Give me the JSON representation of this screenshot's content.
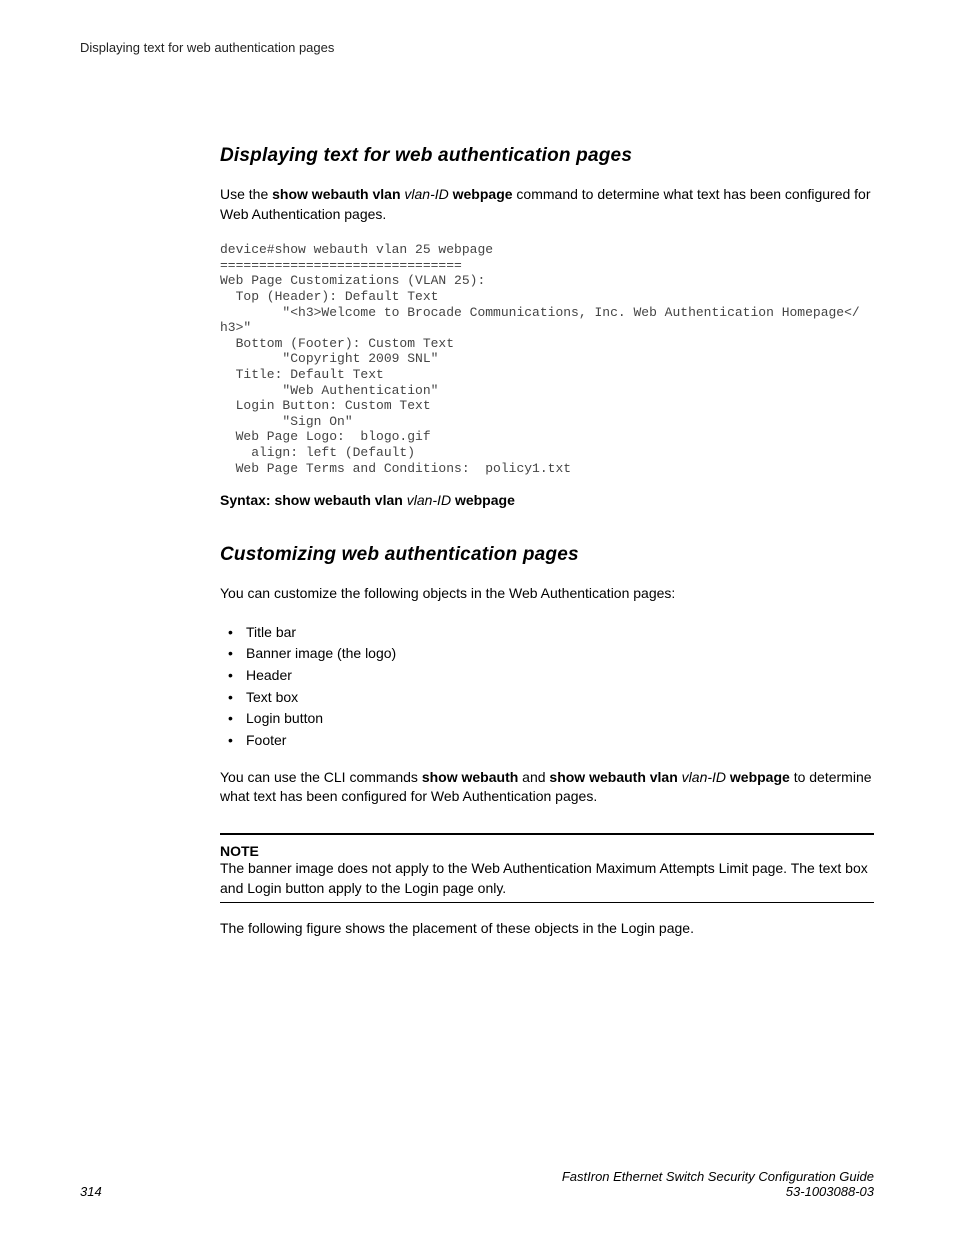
{
  "header": "Displaying text for web authentication pages",
  "section1": {
    "title": "Displaying text for web authentication pages",
    "intro_pre": "Use the ",
    "intro_bold1": "show webauth vlan ",
    "intro_italic1": "vlan-ID ",
    "intro_bold2": "webpage",
    "intro_post": " command to determine what text has been configured for Web Authentication pages.",
    "code": "device#show webauth vlan 25 webpage\n===============================\nWeb Page Customizations (VLAN 25):\n  Top (Header): Default Text\n        \"<h3>Welcome to Brocade Communications, Inc. Web Authentication Homepage</\nh3>\"\n  Bottom (Footer): Custom Text\n        \"Copyright 2009 SNL\"\n  Title: Default Text\n        \"Web Authentication\"\n  Login Button: Custom Text\n        \"Sign On\"\n  Web Page Logo:  blogo.gif\n    align: left (Default)\n  Web Page Terms and Conditions:  policy1.txt",
    "syntax_label": "Syntax: show webauth vlan ",
    "syntax_italic": "vlan-ID",
    "syntax_post": " webpage"
  },
  "section2": {
    "title": "Customizing web authentication pages",
    "intro": "You can customize the following objects in the Web Authentication pages:",
    "bullets": [
      "Title bar",
      "Banner image (the logo)",
      "Header",
      "Text box",
      "Login button",
      "Footer"
    ],
    "para2_pre": "You can use the CLI commands ",
    "para2_b1": "show webauth",
    "para2_mid": " and ",
    "para2_b2": "show webauth vlan ",
    "para2_i1": "vlan-ID ",
    "para2_b3": "webpage",
    "para2_post": " to determine what text has been configured for Web Authentication pages.",
    "note_label": "NOTE",
    "note_body": "The banner image does not apply to the Web Authentication Maximum Attempts Limit page. The text box and Login button apply to the Login page only.",
    "para3": "The following figure shows the placement of these objects in the Login page."
  },
  "footer": {
    "page": "314",
    "guide": "FastIron Ethernet Switch Security Configuration Guide",
    "docnum": "53-1003088-03"
  }
}
